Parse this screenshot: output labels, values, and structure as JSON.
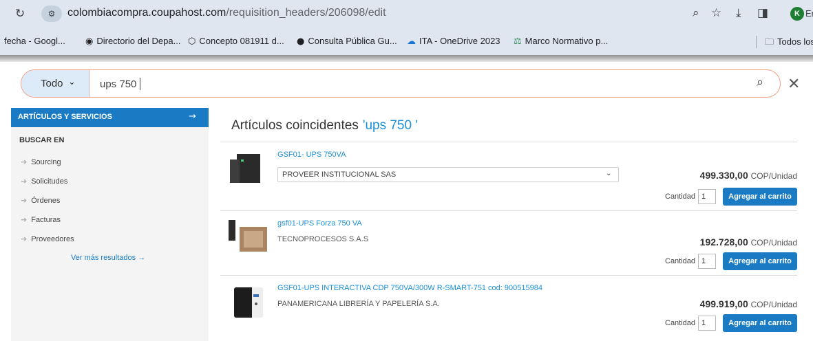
{
  "browser": {
    "url_host": "colombiacompra.coupahost.com",
    "url_path": "/requisition_headers/206098/edit",
    "icons": {
      "reload": "reload-icon",
      "site_info": "tune-icon",
      "zoom": "magnifier-icon",
      "bookmark": "star-icon",
      "download": "download-icon",
      "sidepanel": "side-panel-icon"
    },
    "profile_initial": "K",
    "profile_text": "Er",
    "bookmarks": [
      {
        "label": "fecha - Googl..."
      },
      {
        "label": "Directorio del Depa..."
      },
      {
        "label": "Concepto 081911 d..."
      },
      {
        "label": "Consulta Pública Gu..."
      },
      {
        "label": "ITA - OneDrive 2023"
      },
      {
        "label": "Marco Normativo p..."
      }
    ],
    "all_bookmarks": "Todos los m"
  },
  "search": {
    "scope": "Todo",
    "query": "ups 750"
  },
  "sidebar": {
    "header": "ARTÍCULOS Y SERVICIOS",
    "header_arrow": "→",
    "search_in": "BUSCAR EN",
    "items": [
      "Sourcing",
      "Solicitudes",
      "Órdenes",
      "Facturas",
      "Proveedores"
    ],
    "more": "Ver más resultados →"
  },
  "main": {
    "title": "Artículos coincidentes",
    "query_label": "'ups 750 '"
  },
  "products": [
    {
      "name": "GSF01- UPS 750VA",
      "supplier": "PROVEER INSTITUCIONAL SAS",
      "price": "499.330,00",
      "unit": "COP/Unidad",
      "qty_label": "Cantidad",
      "qty": "1",
      "add_label": "Agregar al carrito"
    },
    {
      "name": "gsf01-UPS Forza 750 VA",
      "supplier": "TECNOPROCESOS S.A.S",
      "price": "192.728,00",
      "unit": "COP/Unidad",
      "qty_label": "Cantidad",
      "qty": "1",
      "add_label": "Agregar al carrito"
    },
    {
      "name": "GSF01-UPS INTERACTIVA CDP 750VA/300W R-SMART-751 cod: 900515984",
      "supplier": "PANAMERICANA LIBRERÍA Y PAPELERÍA S.A.",
      "price": "499.919,00",
      "unit": "COP/Unidad",
      "qty_label": "Cantidad",
      "qty": "1",
      "add_label": "Agregar al carrito"
    }
  ],
  "colors": {
    "accent": "#1a7bc4",
    "link": "#1a8fd6",
    "search_border": "#f2a088",
    "scope_bg": "#ddeaf7"
  }
}
